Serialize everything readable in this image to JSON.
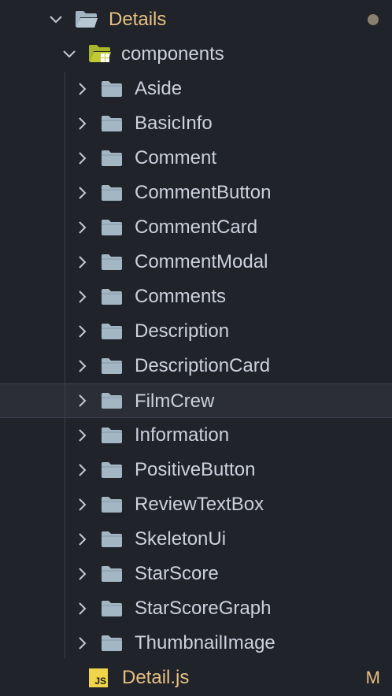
{
  "explorer": {
    "root": {
      "label": "Details",
      "expanded": true,
      "icon": "folder-open-icon",
      "modified_indicator": true
    },
    "components": {
      "label": "components",
      "expanded": true,
      "icon": "folder-components-open-icon"
    },
    "folders": [
      {
        "label": "Aside"
      },
      {
        "label": "BasicInfo"
      },
      {
        "label": "Comment"
      },
      {
        "label": "CommentButton"
      },
      {
        "label": "CommentCard"
      },
      {
        "label": "CommentModal"
      },
      {
        "label": "Comments"
      },
      {
        "label": "Description"
      },
      {
        "label": "DescriptionCard"
      },
      {
        "label": "FilmCrew",
        "selected": true
      },
      {
        "label": "Information"
      },
      {
        "label": "PositiveButton"
      },
      {
        "label": "ReviewTextBox"
      },
      {
        "label": "SkeletonUi"
      },
      {
        "label": "StarScore"
      },
      {
        "label": "StarScoreGraph"
      },
      {
        "label": "ThumbnailImage"
      }
    ],
    "file": {
      "label": "Detail.js",
      "icon_text": "JS",
      "git_status": "M"
    }
  },
  "colors": {
    "background": "#21232b",
    "selected_row": "#2b2e37",
    "modified_text": "#e6c181",
    "folder_text": "#cdd1dc",
    "folder_icon": "#a3b6c3",
    "components_folder_icon": "#c0ca33",
    "js_icon": "#f0d44a"
  }
}
